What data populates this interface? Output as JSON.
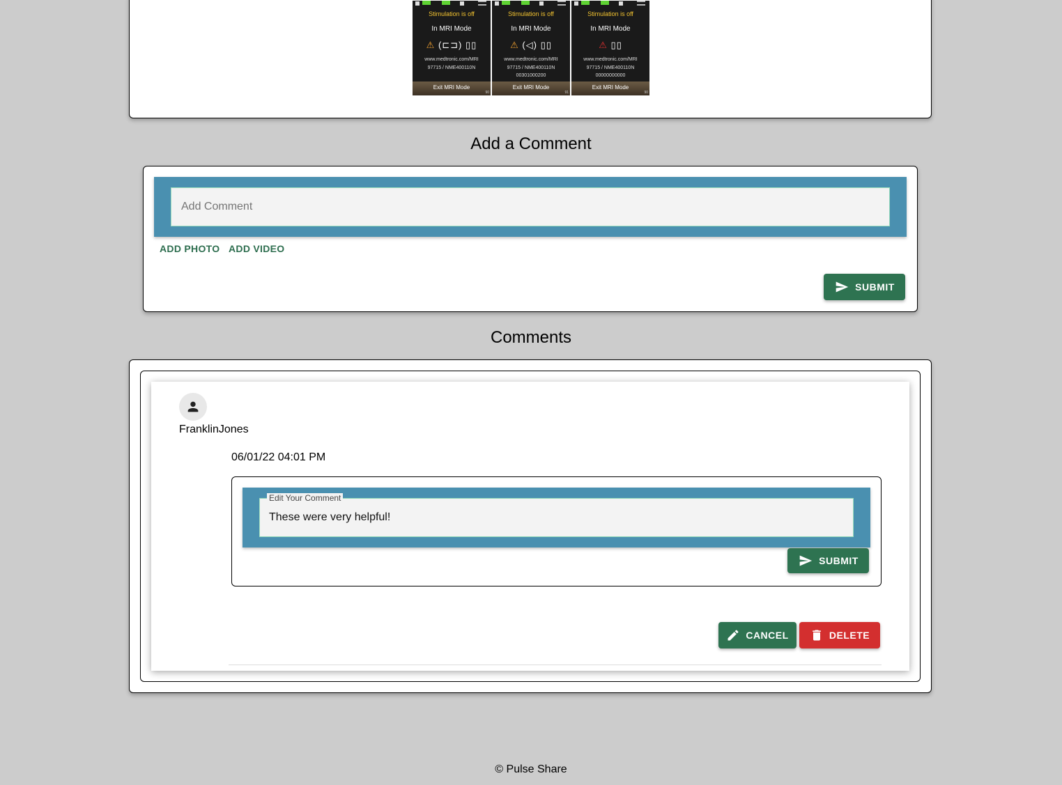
{
  "post": {
    "devices": [
      {
        "status": "Stimulation is off",
        "mode": "In MRI Mode",
        "icons": "⚠ (⊏⊐) 📖",
        "url": "www.medtronic.com/MRI",
        "model": "97715 / NME400110N",
        "serial": "",
        "exit": "Exit MRI Mode",
        "page": "90"
      },
      {
        "status": "Stimulation is off",
        "mode": "In MRI Mode",
        "icons": "⚠ (◁) 📖",
        "url": "www.medtronic.com/MRI",
        "model": "97715 / NME400110N",
        "serial": "00301000200",
        "exit": "Exit MRI Mode",
        "page": "91"
      },
      {
        "status": "Stimulation is off",
        "mode": "In MRI Mode",
        "icons": "⚠ 📖",
        "url": "www.medtronic.com/MRI",
        "model": "97715 / NME400110N",
        "serial": "00000000000",
        "exit": "Exit MRI Mode",
        "page": "90"
      }
    ]
  },
  "add_comment": {
    "title": "Add a Comment",
    "placeholder": "Add Comment",
    "add_photo": "ADD PHOTO",
    "add_video": "ADD VIDEO",
    "submit": "SUBMIT"
  },
  "comments": {
    "title": "Comments",
    "items": [
      {
        "author": "FranklinJones",
        "timestamp": "06/01/22 04:01 PM",
        "edit_label": "Edit Your Comment",
        "text": "These were very helpful!",
        "submit": "SUBMIT",
        "cancel": "CANCEL",
        "delete": "DELETE"
      }
    ]
  },
  "footer": {
    "text": "© Pulse Share"
  },
  "colors": {
    "accent_green": "#2e7351",
    "danger_red": "#d32f2f",
    "teal": "#4a90b0"
  }
}
